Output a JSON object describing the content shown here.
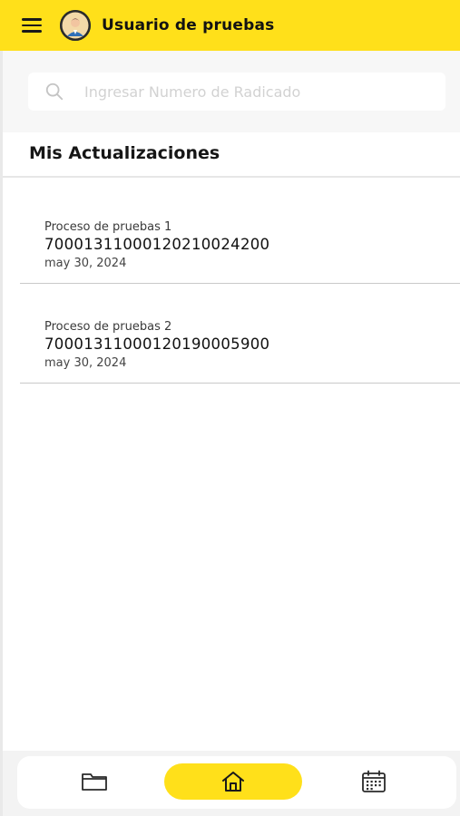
{
  "header": {
    "title": "Usuario de pruebas",
    "menu_icon": "menu-icon",
    "avatar_icon": "user-avatar-icon",
    "background": "#ffe01a"
  },
  "search": {
    "placeholder": "Ingresar Numero de Radicado",
    "value": "",
    "icon": "search-icon"
  },
  "section": {
    "title": "Mis Actualizaciones"
  },
  "updates": [
    {
      "label": "Proceso de pruebas 1",
      "number": "70001311000120210024200",
      "date": "may 30, 2024"
    },
    {
      "label": "Proceso de pruebas 2",
      "number": "70001311000120190005900",
      "date": "may 30, 2024"
    }
  ],
  "bottom_nav": {
    "items": [
      {
        "icon": "folder-icon",
        "active": false
      },
      {
        "icon": "home-icon",
        "active": true
      },
      {
        "icon": "calendar-icon",
        "active": false
      }
    ],
    "active_color": "#ffe01a"
  }
}
